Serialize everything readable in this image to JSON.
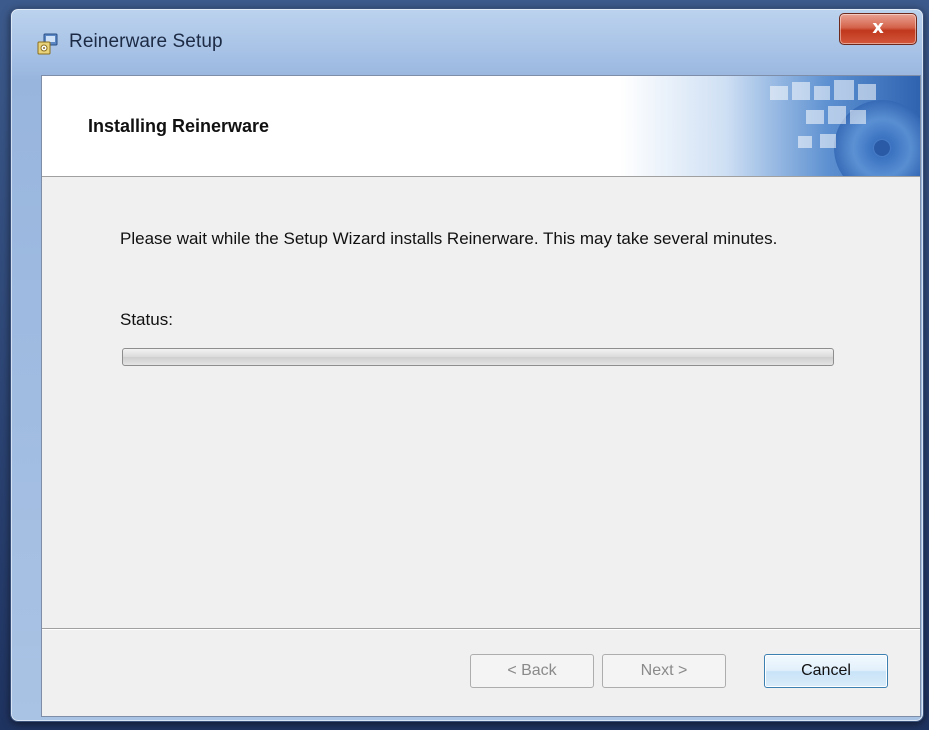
{
  "window": {
    "title": "Reinerware Setup",
    "close_glyph": "x"
  },
  "banner": {
    "title": "Installing Reinerware"
  },
  "content": {
    "message": "Please wait while the Setup Wizard installs Reinerware.  This may take several minutes.",
    "status_label": "Status:",
    "progress_fraction": 0
  },
  "buttons": {
    "back_label": "< Back",
    "next_label": "Next >",
    "cancel_label": "Cancel"
  },
  "icons": {
    "app": "installer-icon",
    "close": "close-icon"
  },
  "colors": {
    "banner_accent": "#2f6fb8",
    "close_button": "#c84a2e",
    "default_button_border": "#3c7fb1"
  }
}
